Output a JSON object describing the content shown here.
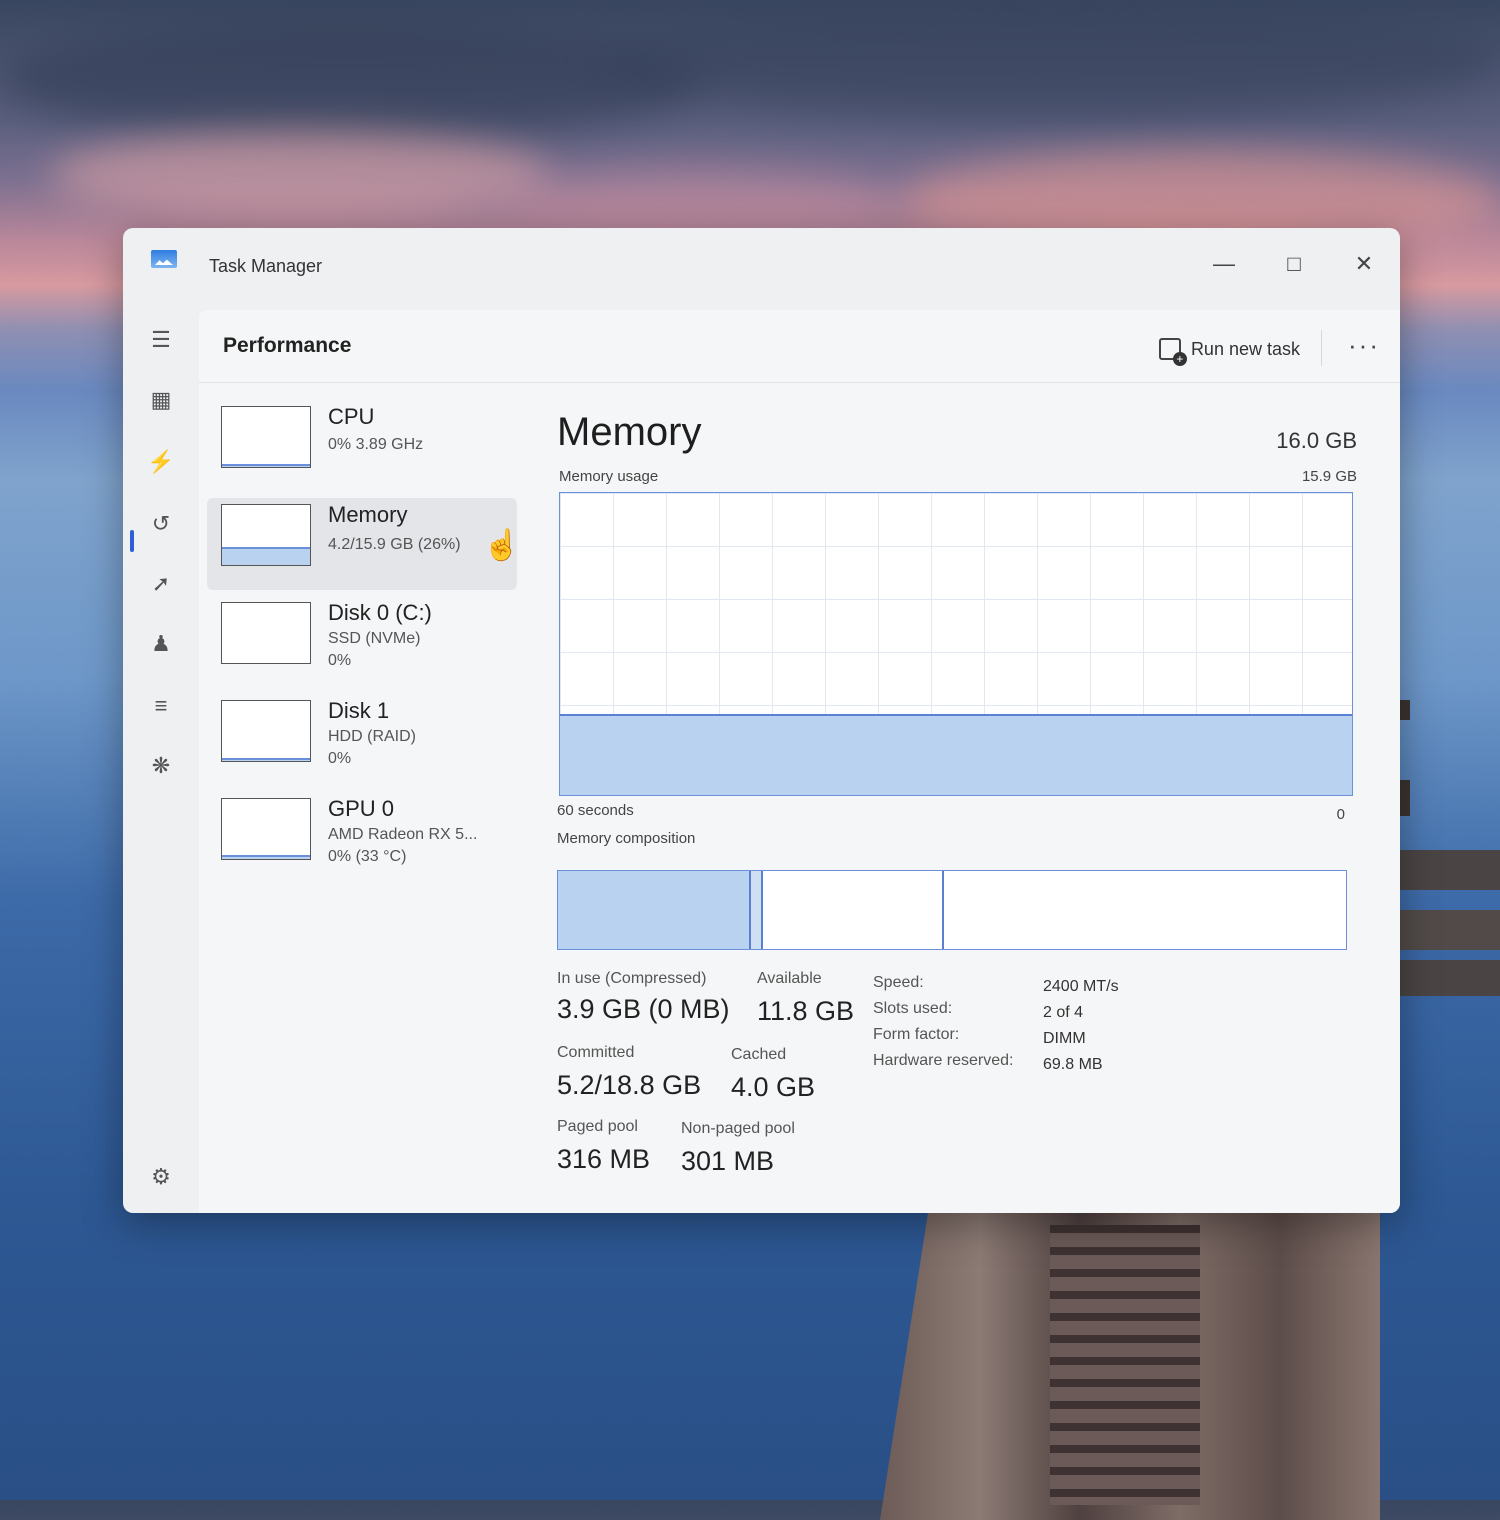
{
  "window": {
    "title": "Task Manager"
  },
  "header": {
    "page_title": "Performance",
    "run_new_task": "Run new task",
    "more": "···"
  },
  "devices": [
    {
      "name": "CPU",
      "sub1": "0% 3.89 GHz",
      "sub2": "",
      "usage": 0.02
    },
    {
      "name": "Memory",
      "sub1": "4.2/15.9 GB (26%)",
      "sub2": "",
      "usage": 0.26
    },
    {
      "name": "Disk 0 (C:)",
      "sub1": "SSD (NVMe)",
      "sub2": "0%",
      "usage": 0
    },
    {
      "name": "Disk 1",
      "sub1": "HDD (RAID)",
      "sub2": "0%",
      "usage": 0.02
    },
    {
      "name": "GPU 0",
      "sub1": "AMD Radeon RX 5...",
      "sub2": "0% (33 °C)",
      "usage": 0.03
    }
  ],
  "memory": {
    "title": "Memory",
    "total": "16.0 GB",
    "usage_label": "Memory usage",
    "usage_max": "15.9 GB",
    "usage_fraction": 0.26,
    "time_left": "60 seconds",
    "time_right": "0",
    "composition_label": "Memory composition",
    "composition": {
      "in_use": 0.245,
      "modified": 0.015,
      "standby": 0.23,
      "free": 0.51
    },
    "stats": {
      "in_use_label": "In use (Compressed)",
      "in_use_value": "3.9 GB (0 MB)",
      "available_label": "Available",
      "available_value": "11.8 GB",
      "committed_label": "Committed",
      "committed_value": "5.2/18.8 GB",
      "cached_label": "Cached",
      "cached_value": "4.0 GB",
      "paged_label": "Paged pool",
      "paged_value": "316 MB",
      "nonpaged_label": "Non-paged pool",
      "nonpaged_value": "301 MB"
    },
    "specs": {
      "speed_label": "Speed:",
      "speed_value": "2400 MT/s",
      "slots_label": "Slots used:",
      "slots_value": "2 of 4",
      "form_label": "Form factor:",
      "form_value": "DIMM",
      "hw_label": "Hardware reserved:",
      "hw_value": "69.8 MB"
    }
  },
  "colors": {
    "accent": "#2f5fd6",
    "graph_fill": "#b9d2f0",
    "graph_line": "#5b7fd3"
  },
  "icons": {
    "minimize": "minimize-icon",
    "maximize": "maximize-icon",
    "close": "close-icon",
    "menu": "hamburger-menu-icon",
    "processes": "processes-icon",
    "performance": "performance-icon",
    "history": "app-history-icon",
    "startup": "startup-apps-icon",
    "users": "users-icon",
    "details": "details-list-icon",
    "services": "services-puzzle-icon",
    "settings": "settings-gear-icon"
  }
}
